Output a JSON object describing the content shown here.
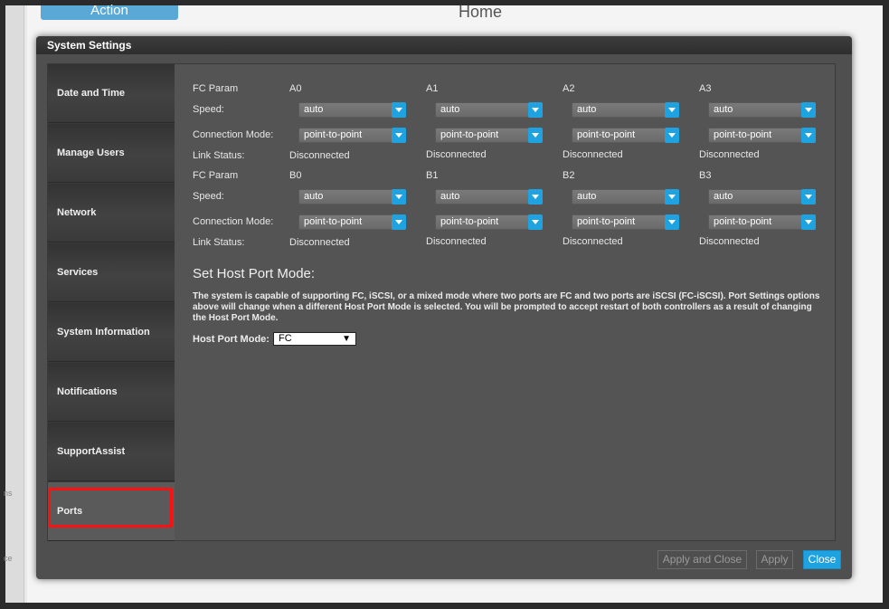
{
  "background": {
    "action_label": "Action",
    "home_title": "Home",
    "left_fragments": [
      "ns",
      "ce"
    ]
  },
  "dialog": {
    "title": "System Settings"
  },
  "sidebar": {
    "items": [
      {
        "label": "Date and Time"
      },
      {
        "label": "Manage Users"
      },
      {
        "label": "Network"
      },
      {
        "label": "Services"
      },
      {
        "label": "System Information"
      },
      {
        "label": "Notifications"
      },
      {
        "label": "SupportAssist"
      },
      {
        "label": "Ports"
      }
    ],
    "active": "Ports"
  },
  "ports": {
    "row_labels": {
      "fc_param": "FC Param",
      "speed": "Speed:",
      "connection_mode": "Connection Mode:",
      "link_status": "Link Status:"
    },
    "group_a": [
      {
        "name": "A0",
        "speed": "auto",
        "mode": "point-to-point",
        "status": "Disconnected"
      },
      {
        "name": "A1",
        "speed": "auto",
        "mode": "point-to-point",
        "status": "Disconnected"
      },
      {
        "name": "A2",
        "speed": "auto",
        "mode": "point-to-point",
        "status": "Disconnected"
      },
      {
        "name": "A3",
        "speed": "auto",
        "mode": "point-to-point",
        "status": "Disconnected"
      }
    ],
    "group_b": [
      {
        "name": "B0",
        "speed": "auto",
        "mode": "point-to-point",
        "status": "Disconnected"
      },
      {
        "name": "B1",
        "speed": "auto",
        "mode": "point-to-point",
        "status": "Disconnected"
      },
      {
        "name": "B2",
        "speed": "auto",
        "mode": "point-to-point",
        "status": "Disconnected"
      },
      {
        "name": "B3",
        "speed": "auto",
        "mode": "point-to-point",
        "status": "Disconnected"
      }
    ]
  },
  "host_port_mode": {
    "title": "Set Host Port Mode:",
    "description": "The system is capable of supporting FC, iSCSI, or a mixed mode where two ports are FC and two ports are iSCSI (FC-iSCSI). Port Settings options above will change when a different Host Port Mode is selected. You will be prompted to accept restart of both controllers as a result of changing the Host Port Mode.",
    "label": "Host Port Mode:",
    "value": "FC"
  },
  "buttons": {
    "apply_and_close": "Apply and Close",
    "apply": "Apply",
    "close": "Close"
  },
  "colors": {
    "accent": "#1fa2e0",
    "highlight": "#ff1010"
  }
}
